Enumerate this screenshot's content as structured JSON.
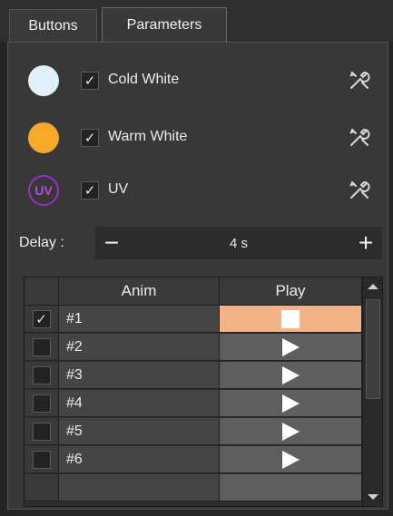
{
  "tabs": [
    {
      "label": "Buttons",
      "active": false
    },
    {
      "label": "Parameters",
      "active": true
    }
  ],
  "lights": [
    {
      "label": "Cold White",
      "checked": true,
      "check_mark": "✓",
      "color": "#dff0fb",
      "icon": "tool-icon"
    },
    {
      "label": "Warm White",
      "checked": true,
      "check_mark": "✓",
      "color": "#f7a92b",
      "icon": "tool-icon"
    },
    {
      "label": "UV",
      "badge": "UV",
      "checked": true,
      "check_mark": "✓",
      "color": "#9b2fc9",
      "icon": "tool-icon"
    }
  ],
  "delay": {
    "label": "Delay :",
    "value": "4 s",
    "minus": "−",
    "plus": "+"
  },
  "table": {
    "headers": [
      "",
      "Anim",
      "Play"
    ],
    "rows": [
      {
        "name": "#1",
        "checked": true,
        "check_mark": "✓",
        "state": "stop"
      },
      {
        "name": "#2",
        "checked": false,
        "check_mark": "",
        "state": "play"
      },
      {
        "name": "#3",
        "checked": false,
        "check_mark": "",
        "state": "play"
      },
      {
        "name": "#4",
        "checked": false,
        "check_mark": "",
        "state": "play"
      },
      {
        "name": "#5",
        "checked": false,
        "check_mark": "",
        "state": "play"
      },
      {
        "name": "#6",
        "checked": false,
        "check_mark": "",
        "state": "play"
      }
    ],
    "playing_color": "#f3b387"
  }
}
